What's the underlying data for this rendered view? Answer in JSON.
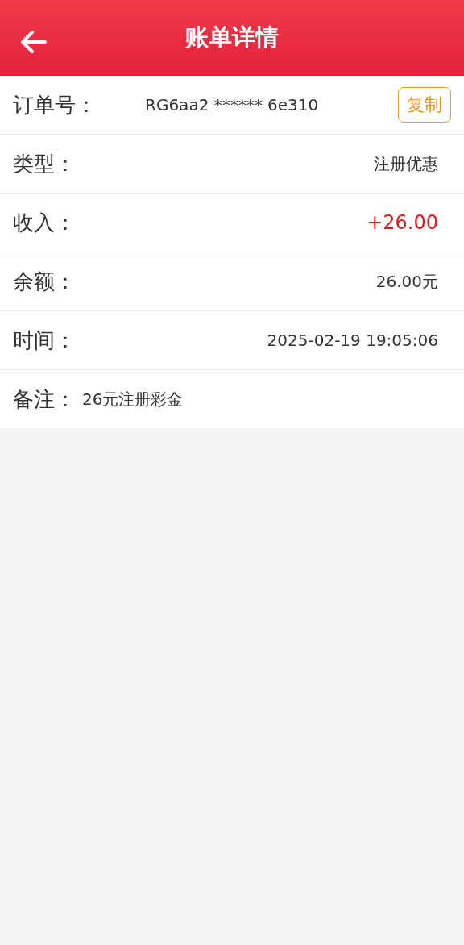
{
  "header": {
    "title": "账单详情"
  },
  "rows": [
    {
      "kind": "order",
      "label": "订单号：",
      "value": "RG6aa2 ****** 6e310",
      "action": "复制"
    },
    {
      "kind": "plain",
      "label": "类型：",
      "value": "注册优惠"
    },
    {
      "kind": "amount",
      "label": "收入：",
      "value": "+26.00"
    },
    {
      "kind": "plain",
      "label": "余额：",
      "value": "26.00元"
    },
    {
      "kind": "plain",
      "label": "时间：",
      "value": "2025-02-19 19:05:06"
    },
    {
      "kind": "note",
      "label": "备注：",
      "value": "26元注册彩金"
    }
  ]
}
